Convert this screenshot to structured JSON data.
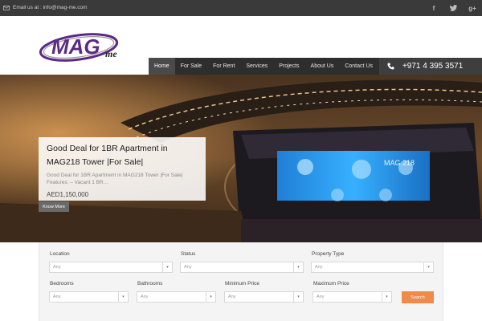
{
  "topbar": {
    "email_text": "Email us at : info@mag-me.com",
    "socials": [
      "facebook-icon",
      "twitter-icon",
      "google-plus-icon"
    ]
  },
  "logo": {
    "main": "MAG",
    "suffix": "me"
  },
  "nav": {
    "items": [
      {
        "label": "Home",
        "active": true
      },
      {
        "label": "For Sale",
        "active": false
      },
      {
        "label": "For Rent",
        "active": false
      },
      {
        "label": "Services",
        "active": false
      },
      {
        "label": "Projects",
        "active": false
      },
      {
        "label": "About Us",
        "active": false
      },
      {
        "label": "Contact Us",
        "active": false
      }
    ],
    "phone": "+971 4 395 3571"
  },
  "hero": {
    "title": "Good Deal for 1BR Apartment in MAG218 Tower |For Sale|",
    "excerpt": "Good Deal for 1BR Apartment in MAG218 Tower |For Sale| Features: – Vacant 1 BR…",
    "price": "AED1,150,000",
    "more_label": "Know More",
    "building_sign": "MAG 218"
  },
  "search": {
    "fields": [
      {
        "label": "Location",
        "value": "Any"
      },
      {
        "label": "Status",
        "value": "Any"
      },
      {
        "label": "Property Type",
        "value": "Any"
      },
      {
        "label": "Bedrooms",
        "value": "Any"
      },
      {
        "label": "Bathrooms",
        "value": "Any"
      },
      {
        "label": "Minimum Price",
        "value": "Any"
      },
      {
        "label": "Maximum Price",
        "value": "Any"
      }
    ],
    "button_label": "Search"
  },
  "colors": {
    "topbar_bg": "#3a3a3a",
    "nav_bg": "#2e2e2e",
    "accent_orange": "#f08a4b",
    "logo_purple": "#5b2a86"
  }
}
